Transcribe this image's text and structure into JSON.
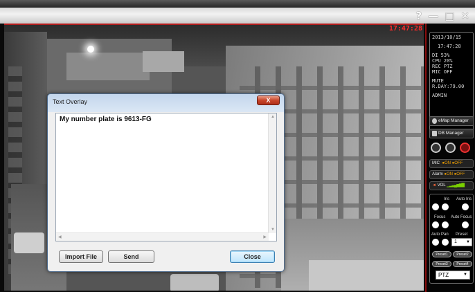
{
  "window_controls": {
    "help": "?",
    "minimize": "—",
    "maximize": "□",
    "close": "✕"
  },
  "feed": {
    "timestamp": "17:47:28"
  },
  "info_panel": {
    "lines": [
      "2013/10/15",
      "17:47:28",
      "DI  53%",
      "CPU  20%",
      "REC  PTZ",
      "MIC OFF",
      "MUTE",
      "R.DAY:79.00",
      "ADMIN"
    ]
  },
  "panel": {
    "emap_label": "eMap Manager",
    "db_label": "DB Manager",
    "mic_label": "MIC",
    "alarm_label": "Alarm",
    "on_label": "ON",
    "off_label": "OFF",
    "vol_label": "VOL",
    "iris_label": "Iris",
    "auto_iris_label": "Auto Iris",
    "focus_label": "Focus",
    "auto_focus_label": "Auto Focus",
    "auto_pan_label": "Auto Pan",
    "preset_label": "Preset",
    "preset_value": "1",
    "preset_buttons": [
      "Preset1",
      "Preset2",
      "Preset3",
      "Preset4"
    ],
    "mode_value": "PTZ"
  },
  "dialog": {
    "title": "Text Overlay",
    "close_x": "X",
    "text_content": "My number plate is 9613-FG",
    "import_label": "Import File",
    "send_label": "Send",
    "close_label": "Close"
  }
}
